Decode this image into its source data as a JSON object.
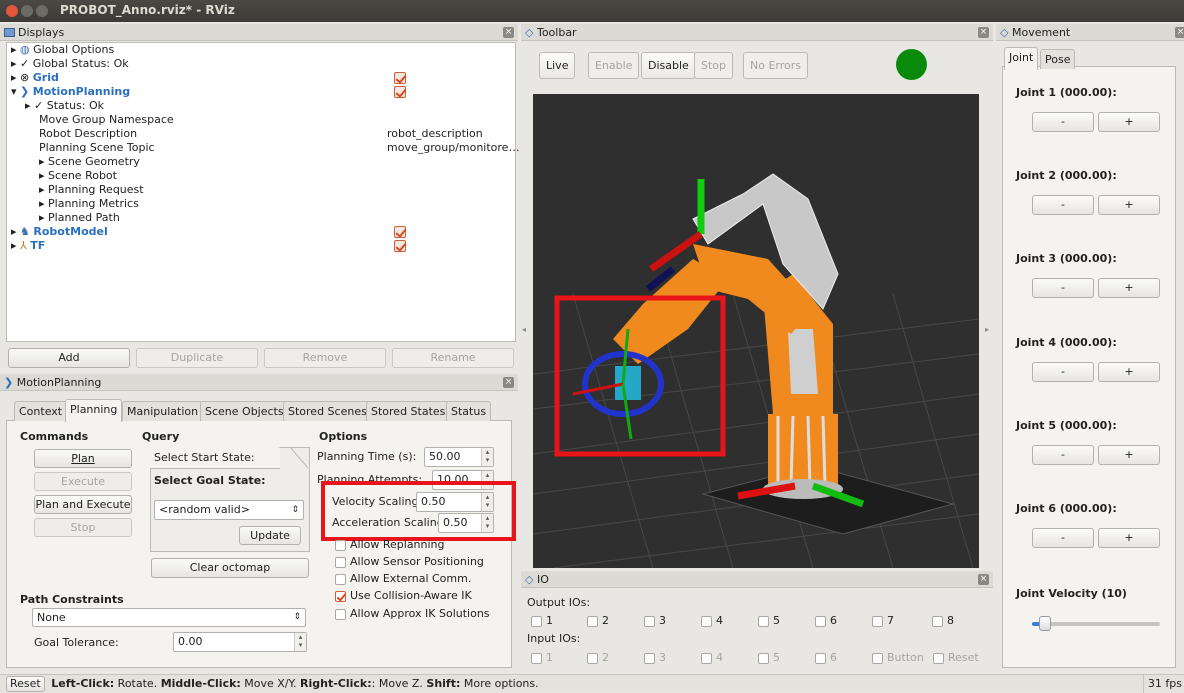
{
  "window": {
    "title": "PROBOT_Anno.rviz* - RViz"
  },
  "displays": {
    "header": "Displays",
    "items": [
      {
        "label": "Global Options",
        "value": ""
      },
      {
        "label": "Global Status: Ok",
        "value": ""
      },
      {
        "label": "Grid",
        "value": ""
      },
      {
        "label": "MotionPlanning",
        "value": ""
      },
      {
        "label": "Status: Ok",
        "value": ""
      },
      {
        "label": "Move Group Namespace",
        "value": ""
      },
      {
        "label": "Robot Description",
        "value": "robot_description"
      },
      {
        "label": "Planning Scene Topic",
        "value": "move_group/monitore…"
      },
      {
        "label": "Scene Geometry",
        "value": ""
      },
      {
        "label": "Scene Robot",
        "value": ""
      },
      {
        "label": "Planning Request",
        "value": ""
      },
      {
        "label": "Planning Metrics",
        "value": ""
      },
      {
        "label": "Planned Path",
        "value": ""
      },
      {
        "label": "RobotModel",
        "value": ""
      },
      {
        "label": "TF",
        "value": ""
      }
    ],
    "buttons": {
      "add": "Add",
      "duplicate": "Duplicate",
      "remove": "Remove",
      "rename": "Rename"
    }
  },
  "motion_planning": {
    "header": "MotionPlanning",
    "tabs": [
      "Context",
      "Planning",
      "Manipulation",
      "Scene Objects",
      "Stored Scenes",
      "Stored States",
      "Status"
    ],
    "commands": {
      "title": "Commands",
      "plan": "Plan",
      "execute": "Execute",
      "plan_and_execute": "Plan and Execute",
      "stop": "Stop"
    },
    "query": {
      "title": "Query",
      "select_start": "Select Start State:",
      "select_goal": "Select Goal State:",
      "goal_value": "<random valid>",
      "update": "Update",
      "clear_octomap": "Clear octomap"
    },
    "options": {
      "title": "Options",
      "planning_time_label": "Planning Time (s):",
      "planning_time_value": "50.00",
      "planning_attempts_label": "Planning Attempts:",
      "planning_attempts_value": "10.00",
      "velocity_label": "Velocity Scaling:",
      "velocity_value": "0.50",
      "acceleration_label": "Acceleration Scaling:",
      "acceleration_value": "0.50",
      "allow_replanning": "Allow Replanning",
      "allow_sensor": "Allow Sensor Positioning",
      "allow_external": "Allow External Comm.",
      "collision_aware": "Use Collision-Aware IK",
      "approx_ik": "Allow Approx IK Solutions"
    },
    "path_constraints": {
      "title": "Path Constraints",
      "value": "None"
    },
    "goal_tolerance": {
      "label": "Goal Tolerance:",
      "value": "0.00"
    }
  },
  "toolbar": {
    "header": "Toolbar",
    "live": "Live",
    "enable": "Enable",
    "disable": "Disable",
    "stop": "Stop",
    "no_errors": "No Errors",
    "status_color": "#0a8a0a"
  },
  "io": {
    "header": "IO",
    "output_label": "Output IOs:",
    "outputs": [
      "1",
      "2",
      "3",
      "4",
      "5",
      "6",
      "7",
      "8"
    ],
    "input_label": "Input IOs:",
    "inputs": [
      "1",
      "2",
      "3",
      "4",
      "5",
      "6",
      "Button",
      "Reset"
    ]
  },
  "movement": {
    "header": "Movement",
    "tabs": [
      "Joint",
      "Pose"
    ],
    "joints": [
      "Joint 1 (000.00):",
      "Joint 2 (000.00):",
      "Joint 3 (000.00):",
      "Joint 4 (000.00):",
      "Joint 5 (000.00):",
      "Joint 6 (000.00):"
    ],
    "minus": "-",
    "plus": "+",
    "velocity_label": "Joint Velocity (10)",
    "velocity_level": 0.1
  },
  "statusbar": {
    "reset": "Reset",
    "left_click": "Left-Click:",
    "left_text": " Rotate. ",
    "middle_click": "Middle-Click:",
    "middle_text": " Move X/Y. ",
    "right_click": "Right-Click:",
    "right_text": ": Move Z. ",
    "shift": "Shift:",
    "shift_text": " More options.",
    "fps": "31 fps"
  },
  "colors": {
    "highlight": "#e8141a",
    "robot_orange": "#f08a1e"
  }
}
